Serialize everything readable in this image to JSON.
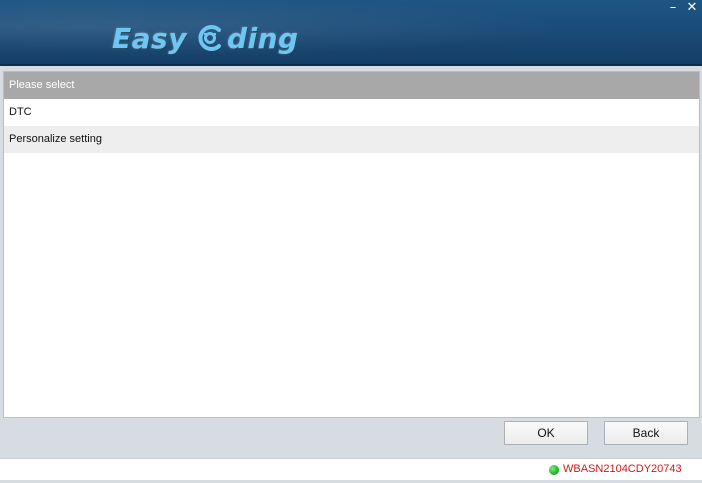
{
  "window": {
    "minimize_label": "–",
    "close_label": "✕"
  },
  "logo": {
    "text_left": "Easy",
    "text_right": "ding",
    "icon": "car-c-icon",
    "color": "#6fc6f0"
  },
  "list": {
    "header": "Please select",
    "items": [
      {
        "label": "DTC"
      },
      {
        "label": "Personalize setting"
      }
    ]
  },
  "buttons": {
    "ok_label": "OK",
    "back_label": "Back"
  },
  "status": {
    "vin": "WBASN2104CDY20743",
    "indicator_color": "#13a813",
    "text_color": "#cc1a1a"
  }
}
